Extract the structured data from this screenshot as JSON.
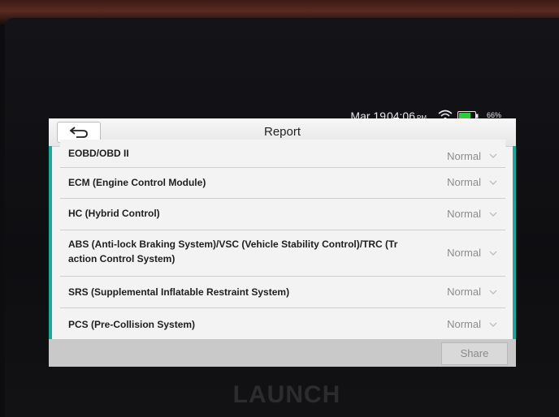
{
  "status_bar": {
    "date": "Mar 19",
    "time": "04:06",
    "ampm": "PM",
    "battery": "66%"
  },
  "header": {
    "title": "Report",
    "back_icon": "back-arrow-icon"
  },
  "report_items": [
    {
      "label": "EOBD/OBD II",
      "status": "Normal"
    },
    {
      "label": "ECM (Engine Control Module)",
      "status": "Normal"
    },
    {
      "label": "HC (Hybrid Control)",
      "status": "Normal"
    },
    {
      "label": "ABS (Anti-lock Braking System)/VSC (Vehicle Stability Control)/TRC (Tr",
      "label_line2": "action Control System)",
      "status": "Normal"
    },
    {
      "label": "SRS (Supplemental Inflatable Restraint System)",
      "status": "Normal"
    },
    {
      "label": "PCS (Pre-Collision System)",
      "status": "Normal"
    }
  ],
  "footer": {
    "share_label": "Share"
  },
  "device": {
    "brand": "LAUNCH"
  },
  "colors": {
    "accent": "#1fa89a",
    "status_text": "#8c8c8c"
  }
}
